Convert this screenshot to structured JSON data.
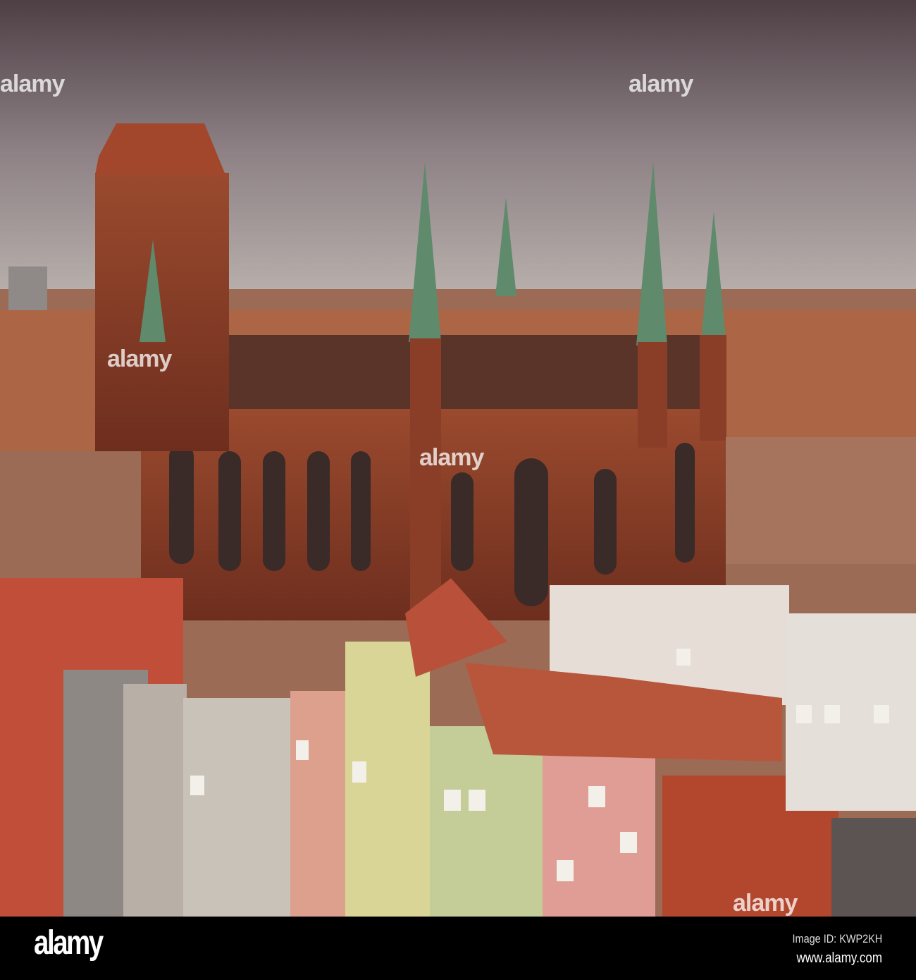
{
  "watermark": {
    "text": "alamy"
  },
  "footer": {
    "logo": "alamy",
    "image_id": "Image ID: KWP2KH",
    "url": "www.alamy.com"
  },
  "colors": {
    "sky": "#7d6f70",
    "brick": "#8a3e28",
    "roof": "#a84a30",
    "copper": "#5f8a6c"
  }
}
